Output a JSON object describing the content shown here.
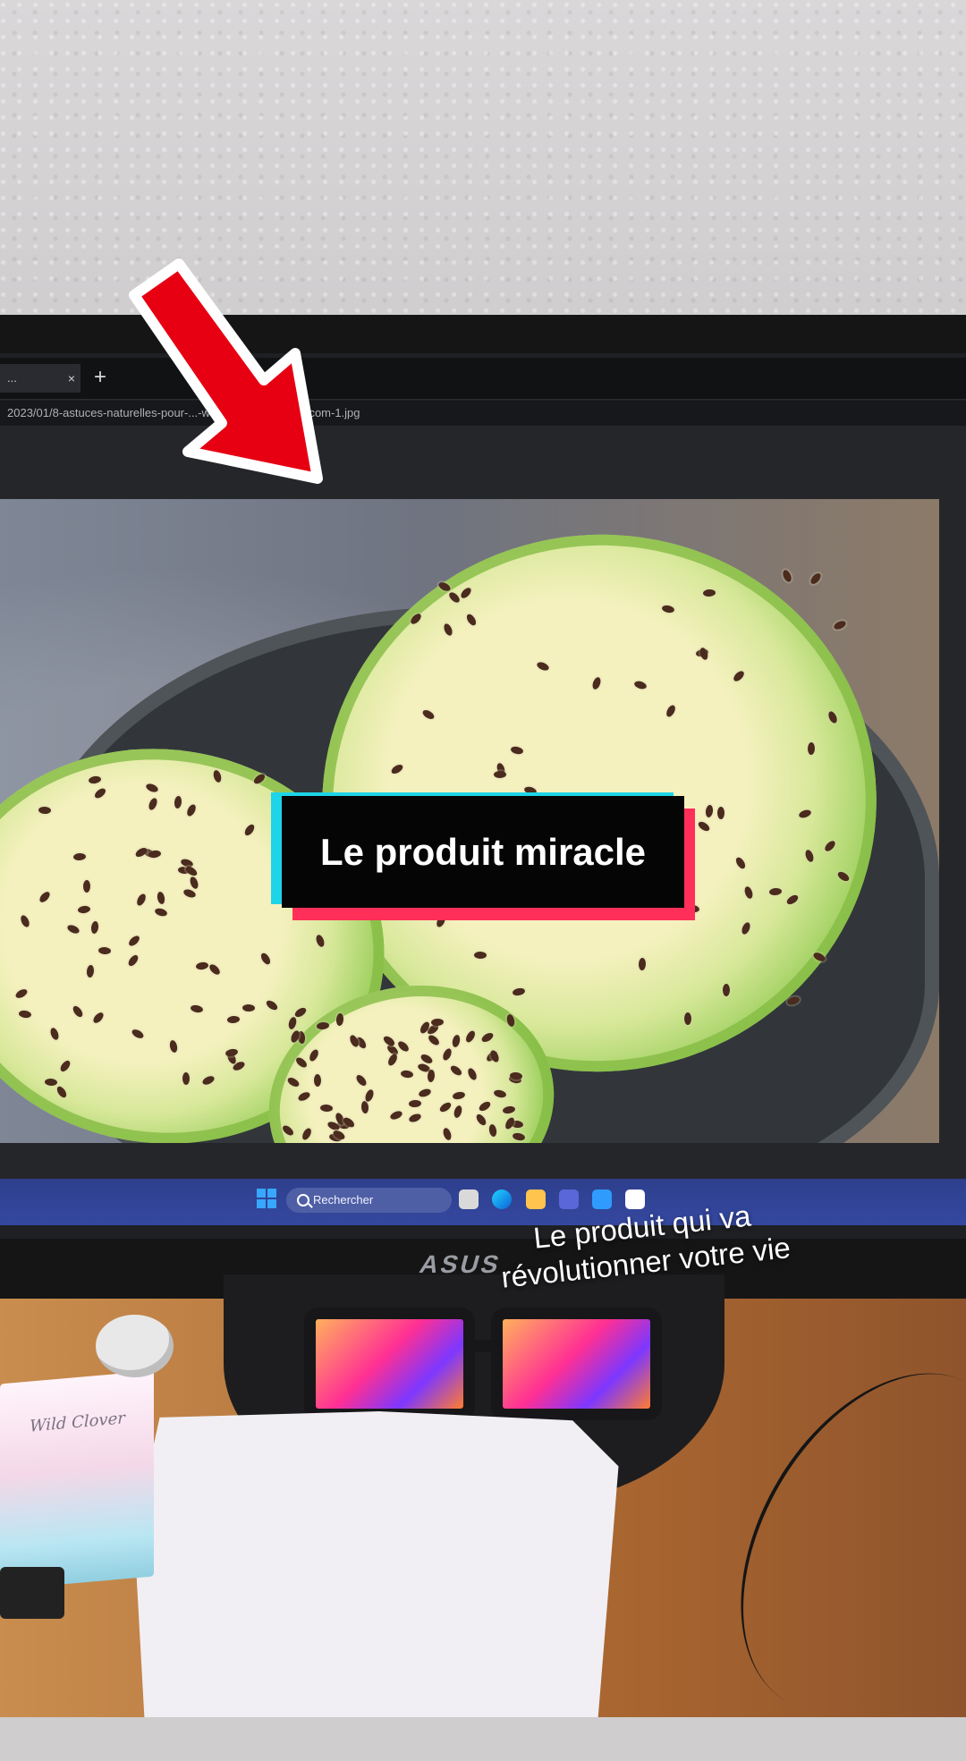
{
  "browser": {
    "tab_label": "...",
    "tab_close": "×",
    "new_tab_label": "+",
    "url": "2023/01/8-astuces-naturelles-pour-...-www.astucesdefilles.com-1.jpg"
  },
  "overlay": {
    "caption": "Le produit miracle",
    "subtitle": "Le produit qui va\nrévolutionner votre vie"
  },
  "taskbar": {
    "search_label": "Rechercher"
  },
  "hardware": {
    "monitor_brand": "ASUS",
    "box_label": "Wild Clover"
  },
  "icons": [
    "red-arrow-icon",
    "windows-icon",
    "search-icon",
    "edge-icon",
    "folder-icon",
    "store-icon",
    "mail-icon"
  ],
  "colors": {
    "caption_cyan": "#1ed4e8",
    "caption_red": "#ff2f59",
    "caption_bg": "#050505",
    "taskbar": "#3548a0"
  }
}
